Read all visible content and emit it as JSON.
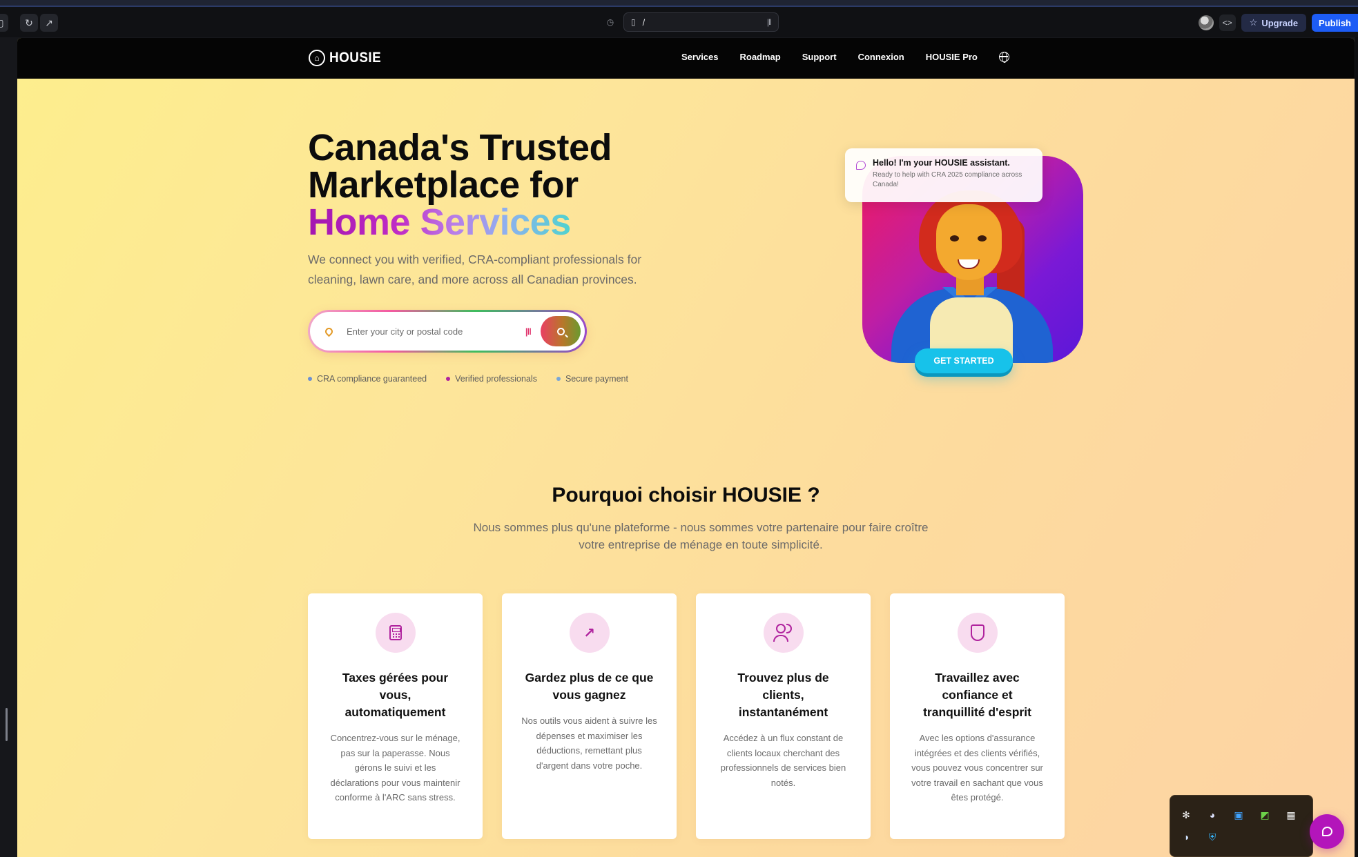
{
  "browser": {
    "url_path": "/",
    "upgrade_label": "Upgrade",
    "publish_label": "Publish"
  },
  "site": {
    "brand": "HOUSIE",
    "nav": [
      "Services",
      "Roadmap",
      "Support",
      "Connexion",
      "HOUSIE Pro"
    ],
    "hero": {
      "title_line1": "Canada's Trusted",
      "title_line2": "Marketplace for",
      "title_accent": "Home Services",
      "subtitle": "We connect you with verified, CRA-compliant professionals for cleaning, lawn care, and more across all Canadian provinces.",
      "search_placeholder": "Enter your city or postal code",
      "badges": [
        {
          "label": "CRA compliance guaranteed",
          "color": "#6b8fd4"
        },
        {
          "label": "Verified professionals",
          "color": "#b0239e"
        },
        {
          "label": "Secure payment",
          "color": "#79a6d8"
        }
      ]
    },
    "assistant": {
      "title": "Hello! I'm your HOUSIE assistant.",
      "message": "Ready to help with CRA 2025 compliance across Canada!"
    },
    "get_started_label": "GET STARTED",
    "why": {
      "title": "Pourquoi choisir HOUSIE ?",
      "subtitle": "Nous sommes plus qu'une plateforme - nous sommes votre partenaire pour faire croître votre entreprise de ménage en toute simplicité.",
      "cards": [
        {
          "icon": "calculator-icon",
          "title": "Taxes gérées pour vous, automatiquement",
          "desc": "Concentrez-vous sur le ménage, pas sur la paperasse. Nous gérons le suivi et les déclarations pour vous maintenir conforme à l'ARC sans stress."
        },
        {
          "icon": "trending-up-icon",
          "title": "Gardez plus de ce que vous gagnez",
          "desc": "Nos outils vous aident à suivre les dépenses et maximiser les déductions, remettant plus d'argent dans votre poche."
        },
        {
          "icon": "users-icon",
          "title": "Trouvez plus de clients, instantanément",
          "desc": "Accédez à un flux constant de clients locaux cherchant des professionnels de services bien notés."
        },
        {
          "icon": "shield-icon",
          "title": "Travaillez avec confiance et tranquillité d'esprit",
          "desc": "Avec les options d'assurance intégrées et des clients vérifiés, vous pouvez vous concentrer sur votre travail en sachant que vous êtes protégé."
        }
      ]
    }
  }
}
